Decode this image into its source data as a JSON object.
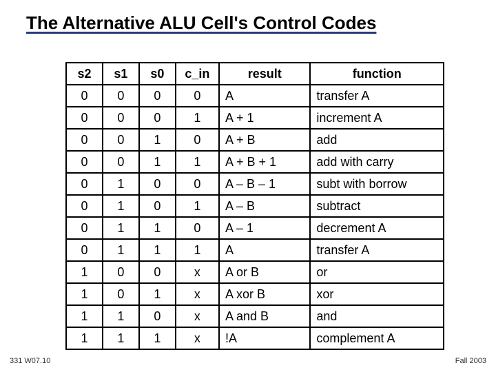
{
  "title": "The Alternative ALU Cell's Control Codes",
  "headers": {
    "s2": "s2",
    "s1": "s1",
    "s0": "s0",
    "c_in": "c_in",
    "result": "result",
    "function": "function"
  },
  "rows": [
    {
      "s2": "0",
      "s1": "0",
      "s0": "0",
      "c_in": "0",
      "result": "A",
      "function": "transfer A"
    },
    {
      "s2": "0",
      "s1": "0",
      "s0": "0",
      "c_in": "1",
      "result": "A + 1",
      "function": "increment A"
    },
    {
      "s2": "0",
      "s1": "0",
      "s0": "1",
      "c_in": "0",
      "result": "A + B",
      "function": "add"
    },
    {
      "s2": "0",
      "s1": "0",
      "s0": "1",
      "c_in": "1",
      "result": "A + B + 1",
      "function": "add with carry"
    },
    {
      "s2": "0",
      "s1": "1",
      "s0": "0",
      "c_in": "0",
      "result": "A – B – 1",
      "function": "subt with borrow"
    },
    {
      "s2": "0",
      "s1": "1",
      "s0": "0",
      "c_in": "1",
      "result": "A – B",
      "function": "subtract"
    },
    {
      "s2": "0",
      "s1": "1",
      "s0": "1",
      "c_in": "0",
      "result": "A – 1",
      "function": "decrement A"
    },
    {
      "s2": "0",
      "s1": "1",
      "s0": "1",
      "c_in": "1",
      "result": "A",
      "function": "transfer A"
    },
    {
      "s2": "1",
      "s1": "0",
      "s0": "0",
      "c_in": "x",
      "result": "A or B",
      "function": "or"
    },
    {
      "s2": "1",
      "s1": "0",
      "s0": "1",
      "c_in": "x",
      "result": "A xor B",
      "function": "xor"
    },
    {
      "s2": "1",
      "s1": "1",
      "s0": "0",
      "c_in": "x",
      "result": "A and B",
      "function": "and"
    },
    {
      "s2": "1",
      "s1": "1",
      "s0": "1",
      "c_in": "x",
      "result": "!A",
      "function": "complement A"
    }
  ],
  "footer": {
    "left": "331 W07.10",
    "right": "Fall 2003"
  },
  "chart_data": {
    "type": "table",
    "title": "The Alternative ALU Cell's Control Codes",
    "columns": [
      "s2",
      "s1",
      "s0",
      "c_in",
      "result",
      "function"
    ],
    "data": [
      [
        "0",
        "0",
        "0",
        "0",
        "A",
        "transfer A"
      ],
      [
        "0",
        "0",
        "0",
        "1",
        "A + 1",
        "increment A"
      ],
      [
        "0",
        "0",
        "1",
        "0",
        "A + B",
        "add"
      ],
      [
        "0",
        "0",
        "1",
        "1",
        "A + B + 1",
        "add with carry"
      ],
      [
        "0",
        "1",
        "0",
        "0",
        "A – B – 1",
        "subt with borrow"
      ],
      [
        "0",
        "1",
        "0",
        "1",
        "A – B",
        "subtract"
      ],
      [
        "0",
        "1",
        "1",
        "0",
        "A – 1",
        "decrement A"
      ],
      [
        "0",
        "1",
        "1",
        "1",
        "A",
        "transfer A"
      ],
      [
        "1",
        "0",
        "0",
        "x",
        "A or B",
        "or"
      ],
      [
        "1",
        "0",
        "1",
        "x",
        "A xor B",
        "xor"
      ],
      [
        "1",
        "1",
        "0",
        "x",
        "A and B",
        "and"
      ],
      [
        "1",
        "1",
        "1",
        "x",
        "!A",
        "complement A"
      ]
    ]
  }
}
